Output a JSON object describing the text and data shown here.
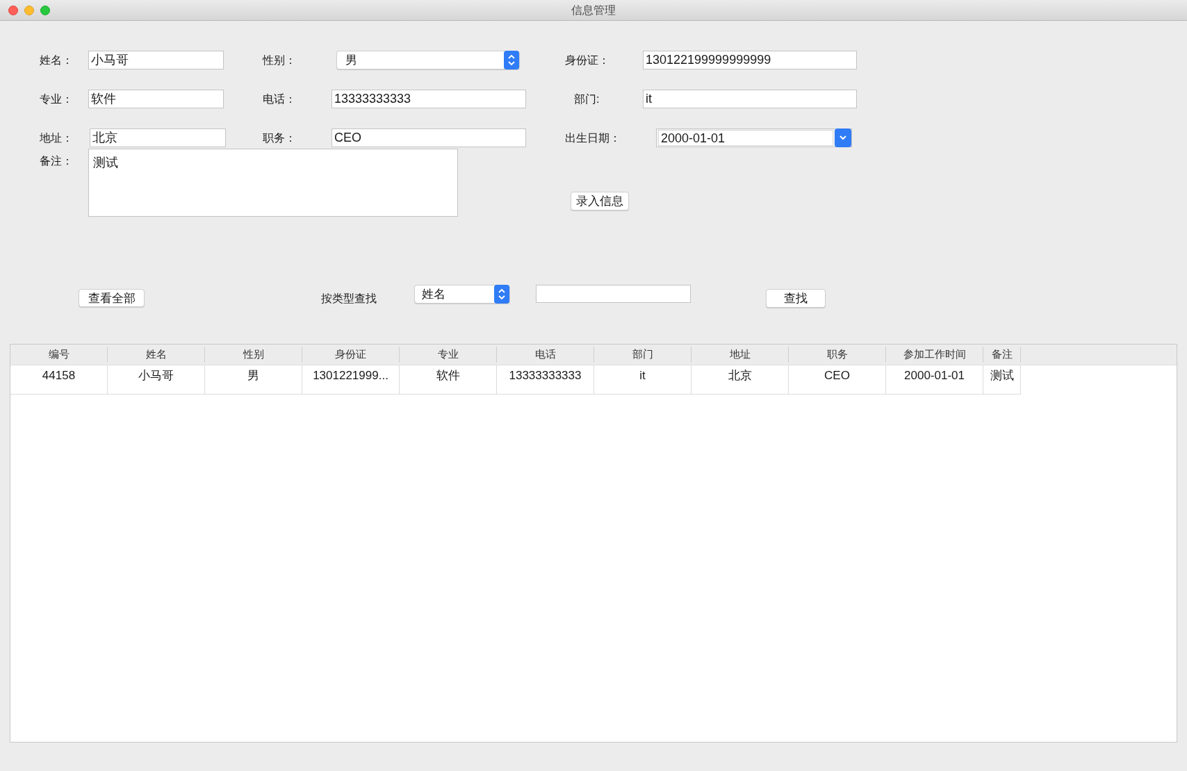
{
  "window": {
    "title": "信息管理"
  },
  "form": {
    "rows": [
      [
        {
          "label": "姓名：",
          "kind": "text",
          "value": "小马哥"
        },
        {
          "label": "性别：",
          "kind": "select",
          "value": "男"
        },
        {
          "label": "身份证：",
          "kind": "text",
          "value": "130122199999999999"
        }
      ],
      [
        {
          "label": "专业：",
          "kind": "text",
          "value": "软件"
        },
        {
          "label": "电话：",
          "kind": "text",
          "value": "13333333333"
        },
        {
          "label": "部门:",
          "kind": "text",
          "value": "it"
        }
      ],
      [
        {
          "label": "地址：",
          "kind": "text",
          "value": "北京"
        },
        {
          "label": "职务：",
          "kind": "text",
          "value": "CEO"
        },
        {
          "label": "出生日期：",
          "kind": "date",
          "value": "2000-01-01"
        }
      ]
    ],
    "remarks": {
      "label": "备注：",
      "value": "测试"
    },
    "submit_button": "录入信息"
  },
  "search": {
    "show_all_button": "查看全部",
    "label": "按类型查找",
    "type_select": "姓名",
    "search_button": "查找"
  },
  "table": {
    "columns": [
      "编号",
      "姓名",
      "性别",
      "身份证",
      "专业",
      "电话",
      "部门",
      "地址",
      "职务",
      "参加工作时间",
      "备注"
    ],
    "rows": [
      [
        "44158",
        "小马哥",
        "男",
        "1301221999...",
        "软件",
        "13333333333",
        "it",
        "北京",
        "CEO",
        "2000-01-01",
        "测试"
      ]
    ]
  }
}
